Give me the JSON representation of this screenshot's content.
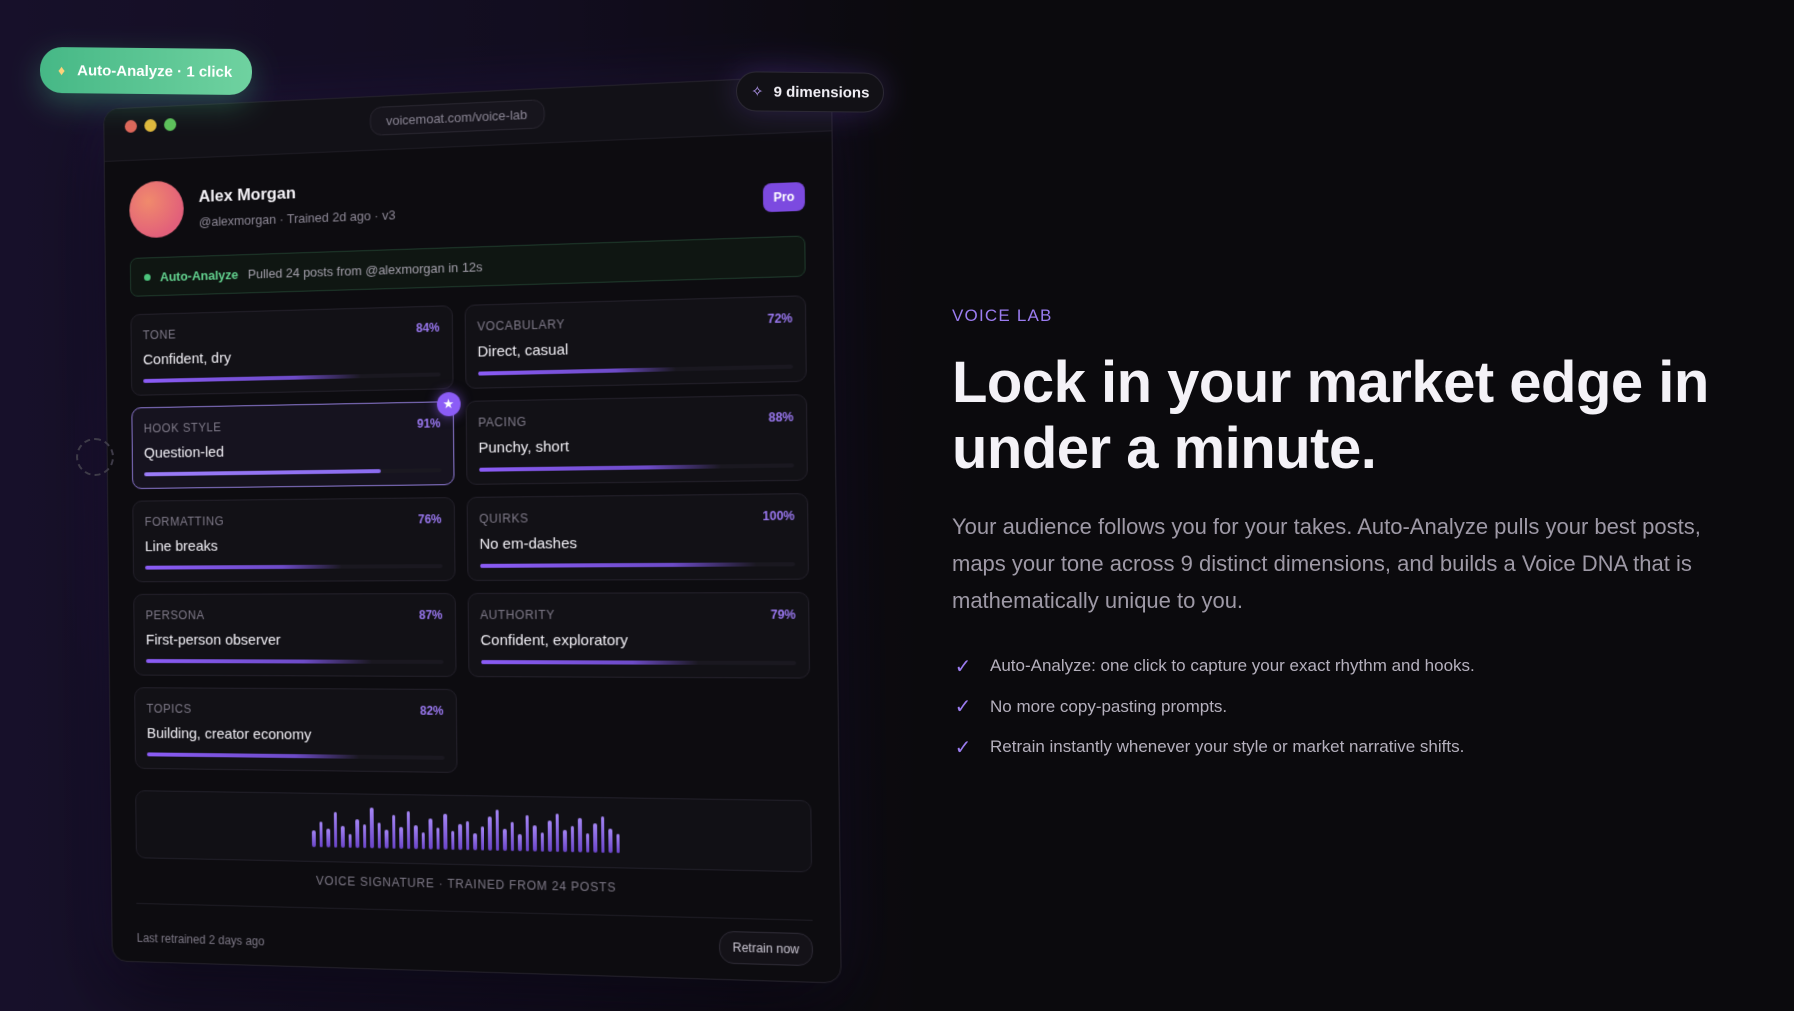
{
  "badges": {
    "auto_analyze": "Auto-Analyze · 1 click",
    "dimensions": "9 dimensions"
  },
  "window": {
    "url": "voicemoat.com/voice-lab"
  },
  "profile": {
    "name": "Alex Morgan",
    "subtitle": "@alexmorgan · Trained 2d ago · v3",
    "plan_badge": "Pro"
  },
  "auto_analyze_status": {
    "label": "Auto-Analyze",
    "message": "Pulled 24 posts from @alexmorgan in 12s",
    "color": "#4cc57d"
  },
  "dimensions": [
    {
      "label": "TONE",
      "value": "Confident, dry",
      "pct_text": "84%",
      "level": 0.84
    },
    {
      "label": "VOCABULARY",
      "value": "Direct, casual",
      "pct_text": "72%",
      "level": 0.72
    },
    {
      "label": "HOOK STYLE",
      "value": "Question-led",
      "pct_text": "91%",
      "level": 0.91,
      "active": true
    },
    {
      "label": "PACING",
      "value": "Punchy, short",
      "pct_text": "88%",
      "level": 0.88
    },
    {
      "label": "FORMATTING",
      "value": "Line breaks",
      "pct_text": "76%",
      "level": 0.76
    },
    {
      "label": "QUIRKS",
      "value": "No em-dashes",
      "pct_text": "100%",
      "level": 1.0
    },
    {
      "label": "PERSONA",
      "value": "First-person observer",
      "pct_text": "87%",
      "level": 0.87
    },
    {
      "label": "AUTHORITY",
      "value": "Confident, exploratory",
      "pct_text": "79%",
      "level": 0.79
    },
    {
      "label": "TOPICS",
      "value": "Building, creator economy",
      "pct_text": "82%",
      "level": 0.82
    }
  ],
  "signature": {
    "caption": "VOICE SIGNATURE · TRAINED FROM 24 POSTS",
    "levels": [
      0.35,
      0.55,
      0.4,
      0.75,
      0.45,
      0.3,
      0.6,
      0.5,
      0.85,
      0.55,
      0.4,
      0.7,
      0.45,
      0.8,
      0.5,
      0.35,
      0.65,
      0.45,
      0.75,
      0.4,
      0.55,
      0.6,
      0.35,
      0.5,
      0.7,
      0.85,
      0.45,
      0.6,
      0.35,
      0.75,
      0.55,
      0.4,
      0.65,
      0.8,
      0.45,
      0.55,
      0.7,
      0.4,
      0.6,
      0.75,
      0.5,
      0.4
    ]
  },
  "footer": {
    "last_retrained": "Last retrained 2 days ago",
    "retrain_button": "Retrain now"
  },
  "hero": {
    "eyebrow": "VOICE LAB",
    "headline_line1": "Lock in your market edge in",
    "headline_line2": "under a minute.",
    "body": "Your audience follows you for your takes. Auto-Analyze pulls your best posts, maps your tone across 9 distinct dimensions, and builds a Voice DNA that is mathematically unique to you.",
    "bullets": [
      "Auto-Analyze: one click to capture your exact rhythm and hooks.",
      "No more copy-pasting prompts.",
      "Retrain instantly whenever your style or market narrative shifts."
    ]
  },
  "colors": {
    "accent": "#8b5cf6",
    "eyebrow": "#9b7cf0",
    "green": "#46b886"
  },
  "icons": {
    "auto_analyze": "flame-icon",
    "dimensions": "dna-icon",
    "star": "star-icon",
    "check": "check-icon"
  }
}
